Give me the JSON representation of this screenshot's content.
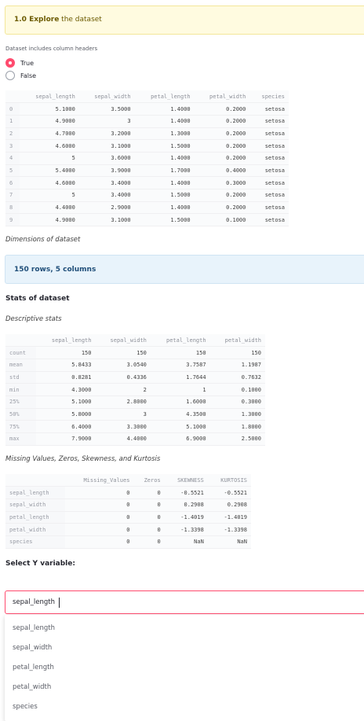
{
  "section": {
    "number": "1.0",
    "title": "Explore",
    "rest": " the dataset"
  },
  "headers_radio": {
    "label": "Dataset includes column headers",
    "options": [
      "True",
      "False"
    ],
    "selected": "True"
  },
  "preview": {
    "columns": [
      "sepal_length",
      "sepal_width",
      "petal_length",
      "petal_width",
      "species"
    ],
    "index": [
      "0",
      "1",
      "2",
      "3",
      "4",
      "5",
      "6",
      "7",
      "8",
      "9"
    ],
    "rows": [
      [
        "5.1000",
        "3.5000",
        "1.4000",
        "0.2000",
        "setosa"
      ],
      [
        "4.9000",
        "3",
        "1.4000",
        "0.2000",
        "setosa"
      ],
      [
        "4.7000",
        "3.2000",
        "1.3000",
        "0.2000",
        "setosa"
      ],
      [
        "4.6000",
        "3.1000",
        "1.5000",
        "0.2000",
        "setosa"
      ],
      [
        "5",
        "3.6000",
        "1.4000",
        "0.2000",
        "setosa"
      ],
      [
        "5.4000",
        "3.9000",
        "1.7000",
        "0.4000",
        "setosa"
      ],
      [
        "4.6000",
        "3.4000",
        "1.4000",
        "0.3000",
        "setosa"
      ],
      [
        "5",
        "3.4000",
        "1.5000",
        "0.2000",
        "setosa"
      ],
      [
        "4.4000",
        "2.9000",
        "1.4000",
        "0.2000",
        "setosa"
      ],
      [
        "4.9000",
        "3.1000",
        "1.5000",
        "0.1000",
        "setosa"
      ]
    ]
  },
  "dims_caption": "Dimensions of dataset",
  "dims_info": {
    "bold": "150 rows, 5 columns"
  },
  "stats_heading": "Stats of dataset",
  "desc_caption": "Descriptive stats",
  "describe": {
    "columns": [
      "sepal_length",
      "sepal_width",
      "petal_length",
      "petal_width"
    ],
    "index": [
      "count",
      "mean",
      "std",
      "min",
      "25%",
      "50%",
      "75%",
      "max"
    ],
    "rows": [
      [
        "150",
        "150",
        "150",
        "150"
      ],
      [
        "5.8433",
        "3.0540",
        "3.7587",
        "1.1987"
      ],
      [
        "0.8281",
        "0.4336",
        "1.7644",
        "0.7632"
      ],
      [
        "4.3000",
        "2",
        "1",
        "0.1000"
      ],
      [
        "5.1000",
        "2.8000",
        "1.6000",
        "0.3000"
      ],
      [
        "5.8000",
        "3",
        "4.3500",
        "1.3000"
      ],
      [
        "6.4000",
        "3.3000",
        "5.1000",
        "1.8000"
      ],
      [
        "7.9000",
        "4.4000",
        "6.9000",
        "2.5000"
      ]
    ]
  },
  "missing_caption": "Missing Values, Zeros, Skewness, and Kurtosis",
  "missing": {
    "columns": [
      "Missing_Values",
      "Zeros",
      "SKEWNESS",
      "KURTOSIS"
    ],
    "index": [
      "sepal_length",
      "sepal_width",
      "petal_length",
      "petal_width",
      "species"
    ],
    "rows": [
      [
        "0",
        "0",
        "-0.5521",
        "-0.5521"
      ],
      [
        "0",
        "0",
        "0.2908",
        "0.2908"
      ],
      [
        "0",
        "0",
        "-1.4019",
        "-1.4019"
      ],
      [
        "0",
        "0",
        "-1.3398",
        "-1.3398"
      ],
      [
        "0",
        "0",
        "NaN",
        "NaN"
      ]
    ]
  },
  "select_y": {
    "label": "Select Y variable:",
    "value": "sepal_length",
    "options": [
      "sepal_length",
      "sepal_width",
      "petal_length",
      "petal_width",
      "species"
    ]
  }
}
